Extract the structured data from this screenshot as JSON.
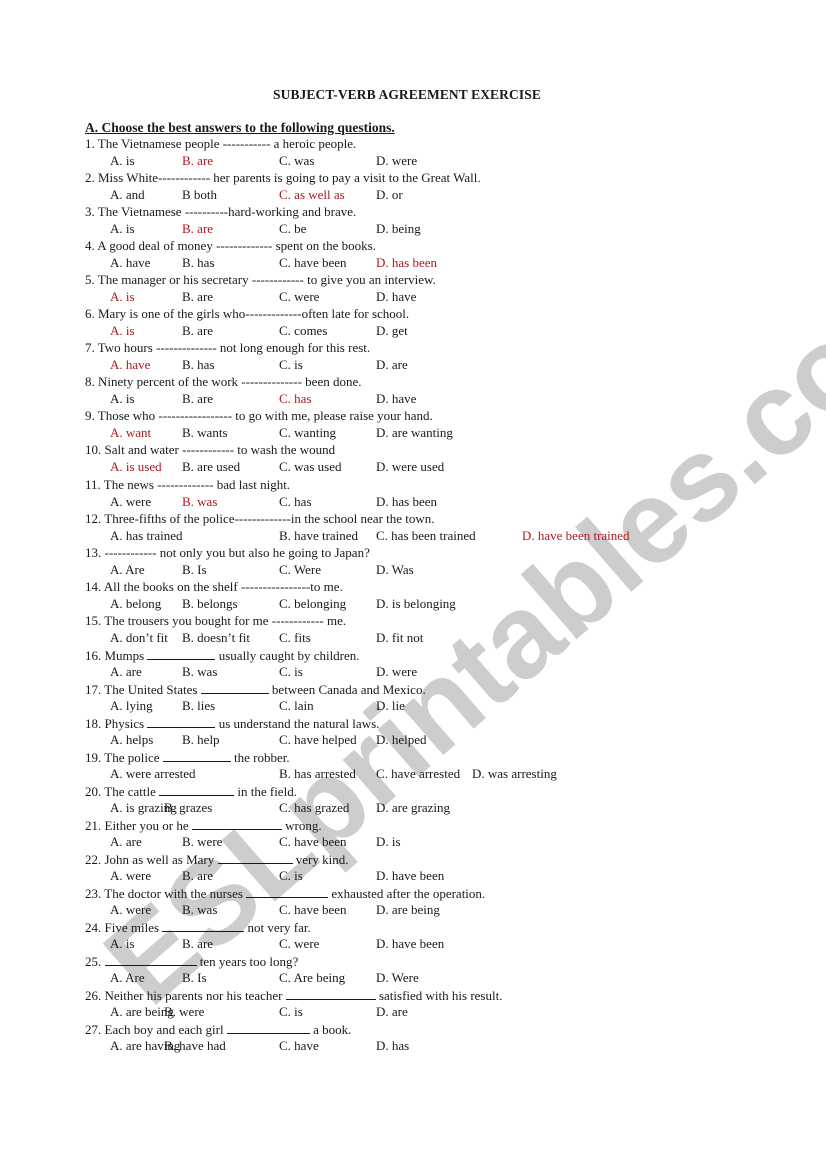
{
  "document": {
    "title": "SUBJECT-VERB AGREEMENT EXERCISE",
    "section_heading": "A. Choose the best answers to the following questions.",
    "watermark": "ESLprintables.com",
    "colors": {
      "text": "#1a1a1a",
      "answer": "#b0171f",
      "watermark": "#c4c4c4"
    }
  },
  "questions": [
    {
      "number": "1.",
      "stem": "The Vietnamese people ----------- a heroic people.",
      "options": [
        {
          "label": "A. is"
        },
        {
          "label": "B. are",
          "correct": true
        },
        {
          "label": "C. was"
        },
        {
          "label": "D. were"
        }
      ]
    },
    {
      "number": "2.",
      "stem": "Miss White------------ her parents is going to pay a visit to the Great Wall.",
      "options": [
        {
          "label": "A. and"
        },
        {
          "label": "B both"
        },
        {
          "label": "C. as well as",
          "correct": true
        },
        {
          "label": "D. or"
        }
      ]
    },
    {
      "number": "3.",
      "stem": "The Vietnamese ----------hard-working and brave.",
      "options": [
        {
          "label": "A. is"
        },
        {
          "label": "B. are",
          "correct": true
        },
        {
          "label": "C. be"
        },
        {
          "label": "D. being"
        }
      ]
    },
    {
      "number": "4.",
      "stem": "A good deal of money ------------- spent on the books.",
      "options": [
        {
          "label": "A. have"
        },
        {
          "label": "B. has"
        },
        {
          "label": "C. have been"
        },
        {
          "label": "D. has been",
          "correct": true
        }
      ]
    },
    {
      "number": "5.",
      "stem": "The manager or his secretary ------------ to give you an interview.",
      "options": [
        {
          "label": "A. is",
          "correct": true
        },
        {
          "label": "B. are"
        },
        {
          "label": "C. were"
        },
        {
          "label": "D. have"
        }
      ]
    },
    {
      "number": "6.",
      "stem": "Mary is one of the girls who-------------often late for school.",
      "options": [
        {
          "label": "A. is",
          "correct": true
        },
        {
          "label": "B. are"
        },
        {
          "label": "C. comes"
        },
        {
          "label": "D. get"
        }
      ]
    },
    {
      "number": "7.",
      "stem": "Two hours -------------- not long enough for this rest.",
      "options": [
        {
          "label": "A. have",
          "correct": true
        },
        {
          "label": "B. has"
        },
        {
          "label": "C. is"
        },
        {
          "label": "D. are"
        }
      ]
    },
    {
      "number": "8.",
      "stem": "Ninety percent of the work -------------- been done.",
      "options": [
        {
          "label": "A. is"
        },
        {
          "label": "B. are"
        },
        {
          "label": "C. has",
          "correct": true
        },
        {
          "label": "D. have"
        }
      ]
    },
    {
      "number": "9.",
      "stem": "Those who ----------------- to go with me, please raise your hand.",
      "options": [
        {
          "label": "A. want",
          "correct": true
        },
        {
          "label": "B. wants"
        },
        {
          "label": "C. wanting"
        },
        {
          "label": "D. are wanting"
        }
      ]
    },
    {
      "number": "10.",
      "stem": "Salt and water ------------ to wash the wound",
      "options": [
        {
          "label": "A. is used",
          "correct": true
        },
        {
          "label": "B. are used"
        },
        {
          "label": "C. was used"
        },
        {
          "label": "D. were used"
        }
      ]
    },
    {
      "number": "11.",
      "stem": "The news ------------- bad last night.",
      "options": [
        {
          "label": "A. were"
        },
        {
          "label": "B. was",
          "correct": true
        },
        {
          "label": "C. has"
        },
        {
          "label": "D. has been"
        }
      ]
    },
    {
      "number": "12.",
      "stem": "Three-fifths of the police-------------in the school near the town.",
      "options": [
        {
          "label": "A. has trained"
        },
        {
          "label": "B. have trained"
        },
        {
          "label": "C. has been trained"
        },
        {
          "label": "D. have been trained",
          "correct": true
        }
      ]
    },
    {
      "number": "13.",
      "stem": "------------ not only you but also he going to Japan?",
      "options": [
        {
          "label": "A. Are"
        },
        {
          "label": "B. Is"
        },
        {
          "label": "C. Were"
        },
        {
          "label": "D. Was"
        }
      ]
    },
    {
      "number": "14.",
      "stem": "All the books on the shelf ----------------to me.",
      "options": [
        {
          "label": "A. belong"
        },
        {
          "label": "B. belongs"
        },
        {
          "label": "C. belonging"
        },
        {
          "label": "D. is belonging"
        }
      ]
    },
    {
      "number": "15.",
      "stem": "The trousers you bought for me ------------ me.",
      "options": [
        {
          "label": "A. don’t fit"
        },
        {
          "label": "B. doesn’t fit"
        },
        {
          "label": "C. fits"
        },
        {
          "label": "D. fit not"
        }
      ]
    },
    {
      "number": "16.",
      "stem_before": "Mumps",
      "stem_after": "usually caught by children.",
      "options": [
        {
          "label": "A. are"
        },
        {
          "label": "B. was"
        },
        {
          "label": "C. is"
        },
        {
          "label": "D. were"
        }
      ]
    },
    {
      "number": "17.",
      "stem_before": "The United States",
      "stem_after": "between Canada and Mexico.",
      "options": [
        {
          "label": "A. lying"
        },
        {
          "label": "B. lies"
        },
        {
          "label": "C. lain"
        },
        {
          "label": "D. lie"
        }
      ]
    },
    {
      "number": "18.",
      "stem_before": "Physics",
      "stem_after": "us understand the natural laws.",
      "options": [
        {
          "label": "A. helps"
        },
        {
          "label": "B. help"
        },
        {
          "label": "C. have helped"
        },
        {
          "label": "D. helped"
        }
      ]
    },
    {
      "number": "19.",
      "stem_before": "The police",
      "stem_after": "the robber.",
      "options": [
        {
          "label": "A. were arrested"
        },
        {
          "label": "B. has arrested"
        },
        {
          "label": "C. have arrested"
        },
        {
          "label": "D. was arresting"
        }
      ]
    },
    {
      "number": "20.",
      "stem_before": "The cattle",
      "stem_after": "in the field.",
      "options": [
        {
          "label": "A. is grazing"
        },
        {
          "label": "B. grazes"
        },
        {
          "label": "C. has grazed"
        },
        {
          "label": "D. are grazing"
        }
      ]
    },
    {
      "number": "21.",
      "stem_before": "Either you or he",
      "stem_after": "wrong.",
      "options": [
        {
          "label": "A. are"
        },
        {
          "label": "B. were"
        },
        {
          "label": "C. have been"
        },
        {
          "label": "D. is"
        }
      ]
    },
    {
      "number": "22.",
      "stem_before": "John as well as Mary",
      "stem_after": "very kind.",
      "options": [
        {
          "label": "A. were"
        },
        {
          "label": "B. are"
        },
        {
          "label": "C. is"
        },
        {
          "label": "D. have been"
        }
      ]
    },
    {
      "number": "23.",
      "stem_before": "The doctor with the nurses",
      "stem_after": "exhausted after the operation.",
      "options": [
        {
          "label": "A. were"
        },
        {
          "label": "B. was"
        },
        {
          "label": "C. have been"
        },
        {
          "label": "D. are being"
        }
      ]
    },
    {
      "number": "24.",
      "stem_before": "Five miles",
      "stem_after": "not very far.",
      "options": [
        {
          "label": "A. is"
        },
        {
          "label": "B. are"
        },
        {
          "label": "C. were"
        },
        {
          "label": "D. have been"
        }
      ]
    },
    {
      "number": "25.",
      "stem_before": "",
      "stem_after": "ten years too long?",
      "options": [
        {
          "label": "A. Are"
        },
        {
          "label": "B. Is"
        },
        {
          "label": "C. Are being"
        },
        {
          "label": "D. Were"
        }
      ]
    },
    {
      "number": "26.",
      "stem_before": "Neither his parents nor his teacher",
      "stem_after": "satisfied with his result.",
      "options": [
        {
          "label": "A. are being"
        },
        {
          "label": "B. were"
        },
        {
          "label": "C. is"
        },
        {
          "label": "D. are"
        }
      ]
    },
    {
      "number": "27.",
      "stem_before": "Each boy and each girl",
      "stem_after": "a book.",
      "options": [
        {
          "label": "A. are having"
        },
        {
          "label": "B. have had"
        },
        {
          "label": "C. have"
        },
        {
          "label": "D. has"
        }
      ]
    }
  ]
}
